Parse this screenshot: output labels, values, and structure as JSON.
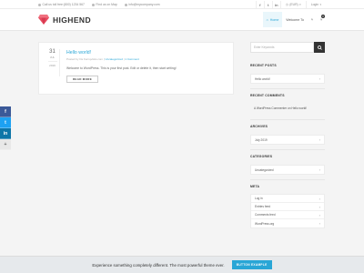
{
  "colors": {
    "accent": "#29a6d6",
    "logo_red": "#e84a5f",
    "facebook": "#3b5998",
    "twitter": "#1da1f2",
    "linkedin": "#0e76a8"
  },
  "topbar": {
    "phone": "Call us toll free:(800) 1234 567",
    "location": "Find us on Map",
    "email": "info@mycompany.com",
    "social": [
      "f",
      "t",
      "in"
    ],
    "currency": "(EUR)",
    "login": "Login"
  },
  "header": {
    "logo": "HIGHEND",
    "nav": [
      {
        "label": "Home",
        "icon": "home-icon",
        "active": true
      },
      {
        "label": "Welcome To",
        "icon": "",
        "active": false
      }
    ],
    "cart_count": "0"
  },
  "post": {
    "day": "31",
    "month": "JUL",
    "pin": "2019",
    "title": "Hello world!",
    "meta_author": "Posted by Iris Fernqvistis.com",
    "meta_cat": "Uncategorized",
    "meta_comments": "1 Comment",
    "body": "Welcome to WordPress. This is your first post. Edit or delete it, then start writing!",
    "read_more": "READ MORE"
  },
  "sidebar": {
    "search_placeholder": "Enter Keywords",
    "recent_posts_title": "RECENT POSTS",
    "recent_posts": [
      "Hello world!"
    ],
    "recent_comments_title": "RECENT COMMENTS",
    "recent_comment_author": "A WordPress Commenter",
    "recent_comment_on": "on",
    "recent_comment_post": "Hello world!",
    "archives_title": "ARCHIVES",
    "archives": [
      "July 2019"
    ],
    "categories_title": "CATEGORIES",
    "categories": [
      "Uncategorized"
    ],
    "meta_title": "META",
    "meta": [
      "Log in",
      "Entries feed",
      "Comments feed",
      "WordPress.org"
    ]
  },
  "social_share": [
    "f",
    "t",
    "in",
    "+"
  ],
  "banner": {
    "text": "Experience something completely different. The most powerful theme ever.",
    "button": "BUTTON EXAMPLE"
  }
}
